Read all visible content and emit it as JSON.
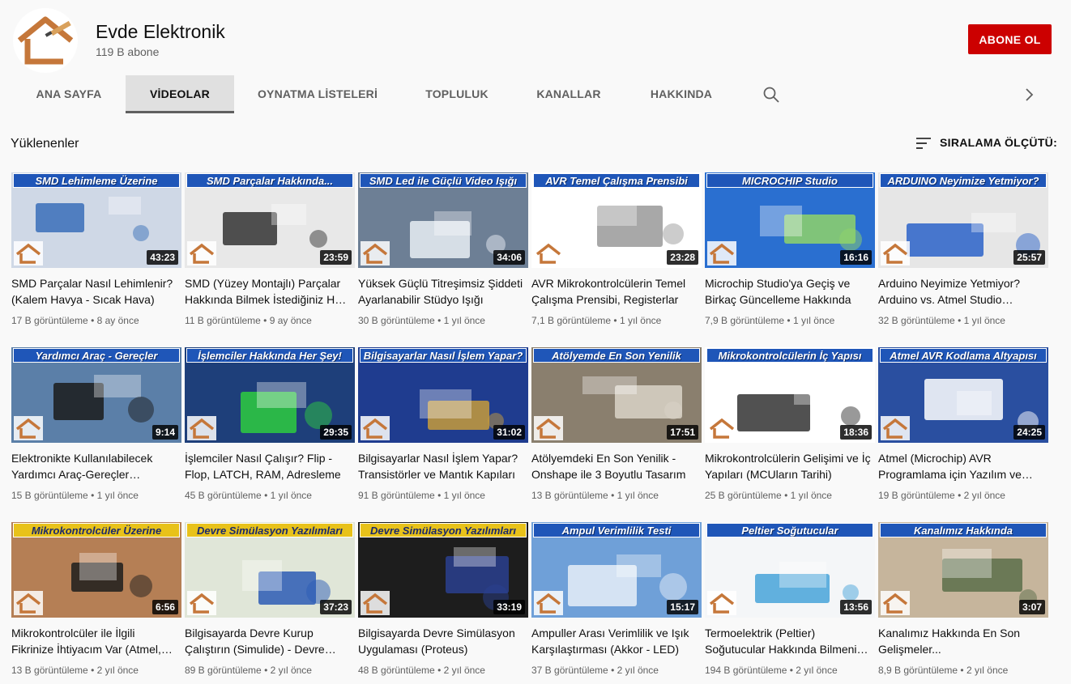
{
  "channel": {
    "name": "Evde Elektronik",
    "subscribers": "119 B abone",
    "subscribe_label": "ABONE OL"
  },
  "tabs": [
    {
      "label": "ANA SAYFA",
      "active": false
    },
    {
      "label": "VİDEOLAR",
      "active": true
    },
    {
      "label": "OYNATMA LİSTELERİ",
      "active": false
    },
    {
      "label": "TOPLULUK",
      "active": false
    },
    {
      "label": "KANALLAR",
      "active": false
    },
    {
      "label": "HAKKINDA",
      "active": false
    }
  ],
  "section": {
    "title": "Yüklenenler",
    "sort_label": "SIRALAMA ÖLÇÜTÜ:"
  },
  "colors": {
    "subscribe": "#cc0000",
    "thumb_banner": "#1f56b8",
    "thumb_banner_yellow": "#e8c21a"
  },
  "videos": [
    {
      "thumb_text": "SMD Lehimleme Üzerine",
      "duration": "43:23",
      "title": "SMD Parçalar Nasıl Lehimlenir? (Kalem Havya - Sıcak Hava)",
      "views": "17 B görüntüleme",
      "age": "8 ay önce"
    },
    {
      "thumb_text": "SMD Parçalar Hakkında...",
      "duration": "23:59",
      "title": "SMD (Yüzey Montajlı) Parçalar Hakkında Bilmek İstediğiniz Her Şey",
      "views": "11 B görüntüleme",
      "age": "9 ay önce"
    },
    {
      "thumb_text": "SMD Led ile Güçlü Video Işığı",
      "duration": "34:06",
      "title": "Yüksek Güçlü Titreşimsiz Şiddeti Ayarlanabilir Stüdyo Işığı",
      "views": "30 B görüntüleme",
      "age": "1 yıl önce"
    },
    {
      "thumb_text": "AVR Temel Çalışma Prensibi",
      "duration": "23:28",
      "title": "AVR Mikrokontrolcülerin Temel Çalışma Prensibi, Registerlar",
      "views": "7,1 B görüntüleme",
      "age": "1 yıl önce"
    },
    {
      "thumb_text": "MICROCHIP Studio",
      "duration": "16:16",
      "title": "Microchip Studio'ya Geçiş ve Birkaç Güncelleme Hakkında",
      "views": "7,9 B görüntüleme",
      "age": "1 yıl önce"
    },
    {
      "thumb_text": "ARDUINO Neyimize Yetmiyor?",
      "duration": "25:57",
      "title": "Arduino Neyimize Yetmiyor? Arduino vs. Atmel Studio Karşılaştırma",
      "views": "32 B görüntüleme",
      "age": "1 yıl önce"
    },
    {
      "thumb_text": "Yardımcı Araç - Gereçler",
      "duration": "9:14",
      "title": "Elektronikte Kullanılabilecek Yardımcı Araç-Gereçler Hakkında",
      "views": "15 B görüntüleme",
      "age": "1 yıl önce"
    },
    {
      "thumb_text": "İşlemciler Hakkında Her Şey!",
      "duration": "29:35",
      "title": "İşlemciler Nasıl Çalışır? Flip - Flop, LATCH, RAM, Adresleme",
      "views": "45 B görüntüleme",
      "age": "1 yıl önce"
    },
    {
      "thumb_text": "Bilgisayarlar Nasıl İşlem Yapar?",
      "duration": "31:02",
      "title": "Bilgisayarlar Nasıl İşlem Yapar? Transistörler ve Mantık Kapıları",
      "views": "91 B görüntüleme",
      "age": "1 yıl önce"
    },
    {
      "thumb_text": "Atölyemde En Son Yenilik",
      "duration": "17:51",
      "title": "Atölyemdeki En Son Yenilik - Onshape ile 3 Boyutlu Tasarım",
      "views": "13 B görüntüleme",
      "age": "1 yıl önce"
    },
    {
      "thumb_text": "Mikrokontrolcülerin İç Yapısı",
      "duration": "18:36",
      "title": "Mikrokontrolcülerin Gelişimi ve İç Yapıları (MCUların Tarihi)",
      "views": "25 B görüntüleme",
      "age": "1 yıl önce"
    },
    {
      "thumb_text": "Atmel AVR Kodlama Altyapısı",
      "duration": "24:25",
      "title": "Atmel (Microchip) AVR Programlama için Yazılım ve Donanım",
      "views": "19 B görüntüleme",
      "age": "2 yıl önce"
    },
    {
      "thumb_text": "Mikrokontrolcüler Üzerine",
      "duration": "6:56",
      "title": "Mikrokontrolcüler ile İlgili Fikrinize İhtiyacım Var (Atmel, PIC)",
      "views": "13 B görüntüleme",
      "age": "2 yıl önce"
    },
    {
      "thumb_text": "Devre Simülasyon Yazılımları",
      "duration": "37:23",
      "title": "Bilgisayarda Devre Kurup Çalıştırın (Simulide) - Devre Simülasyonu",
      "views": "89 B görüntüleme",
      "age": "2 yıl önce"
    },
    {
      "thumb_text": "Devre Simülasyon Yazılımları",
      "duration": "33:19",
      "title": "Bilgisayarda Devre Simülasyon Uygulaması (Proteus)",
      "views": "48 B görüntüleme",
      "age": "2 yıl önce"
    },
    {
      "thumb_text": "Ampul Verimlilik Testi",
      "duration": "15:17",
      "title": "Ampuller Arası Verimlilik ve Işık Karşılaştırması (Akkor - LED)",
      "views": "37 B görüntüleme",
      "age": "2 yıl önce"
    },
    {
      "thumb_text": "Peltier Soğutucular",
      "duration": "13:56",
      "title": "Termoelektrik (Peltier) Soğutucular Hakkında Bilmeniz Gerekenler",
      "views": "194 B görüntüleme",
      "age": "2 yıl önce"
    },
    {
      "thumb_text": "Kanalımız Hakkında",
      "duration": "3:07",
      "title": "Kanalımız Hakkında En Son Gelişmeler...",
      "views": "8,9 B görüntüleme",
      "age": "2 yıl önce"
    }
  ]
}
